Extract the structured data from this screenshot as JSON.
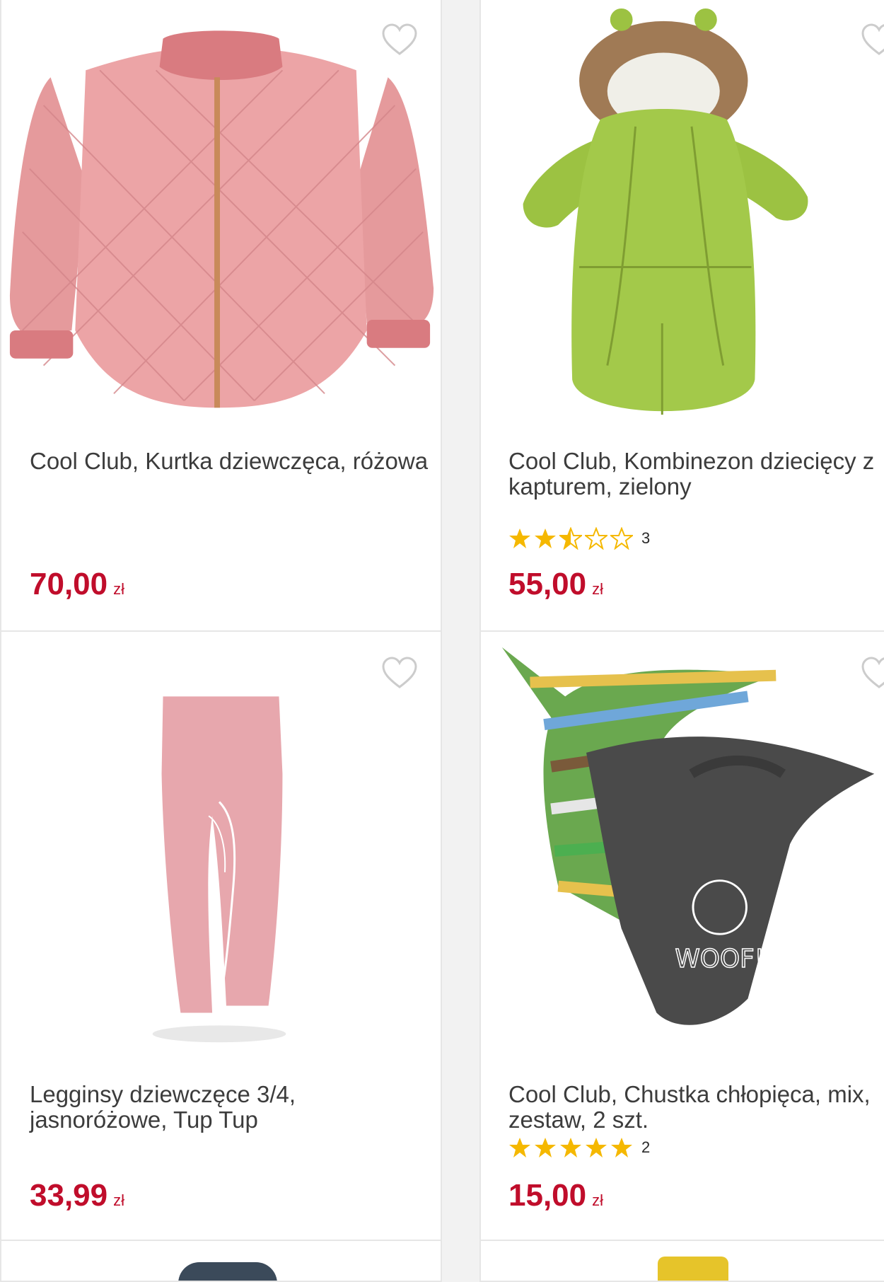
{
  "products": [
    {
      "title": "Cool Club, Kurtka dziewczęca, różowa",
      "price": "70,00",
      "currency": "zł",
      "image": "pink-quilted-jacket",
      "wishlist_icon": "heart-outline-icon"
    },
    {
      "title": "Cool Club, Kombinezon dziecięcy z kapturem, zielony",
      "price": "55,00",
      "currency": "zł",
      "rating": 2.5,
      "rating_count": "3",
      "image": "green-baby-snowsuit",
      "wishlist_icon": "heart-outline-icon"
    },
    {
      "title": "Legginsy dziewczęce 3/4, jasnoróżowe, Tup Tup",
      "price": "33,99",
      "currency": "zł",
      "image": "pink-leggings",
      "wishlist_icon": "heart-outline-icon"
    },
    {
      "title": "Cool Club, Chustka chłopięca, mix, zestaw, 2 szt.",
      "price": "15,00",
      "currency": "zł",
      "rating": 5,
      "rating_count": "2",
      "image": "bandana-set",
      "image_text": "WOOF!",
      "wishlist_icon": "heart-outline-icon"
    }
  ],
  "colors": {
    "price": "#c00d2b",
    "star": "#f5b800",
    "star_empty": "#f5b800",
    "heart": "#cccccc"
  }
}
